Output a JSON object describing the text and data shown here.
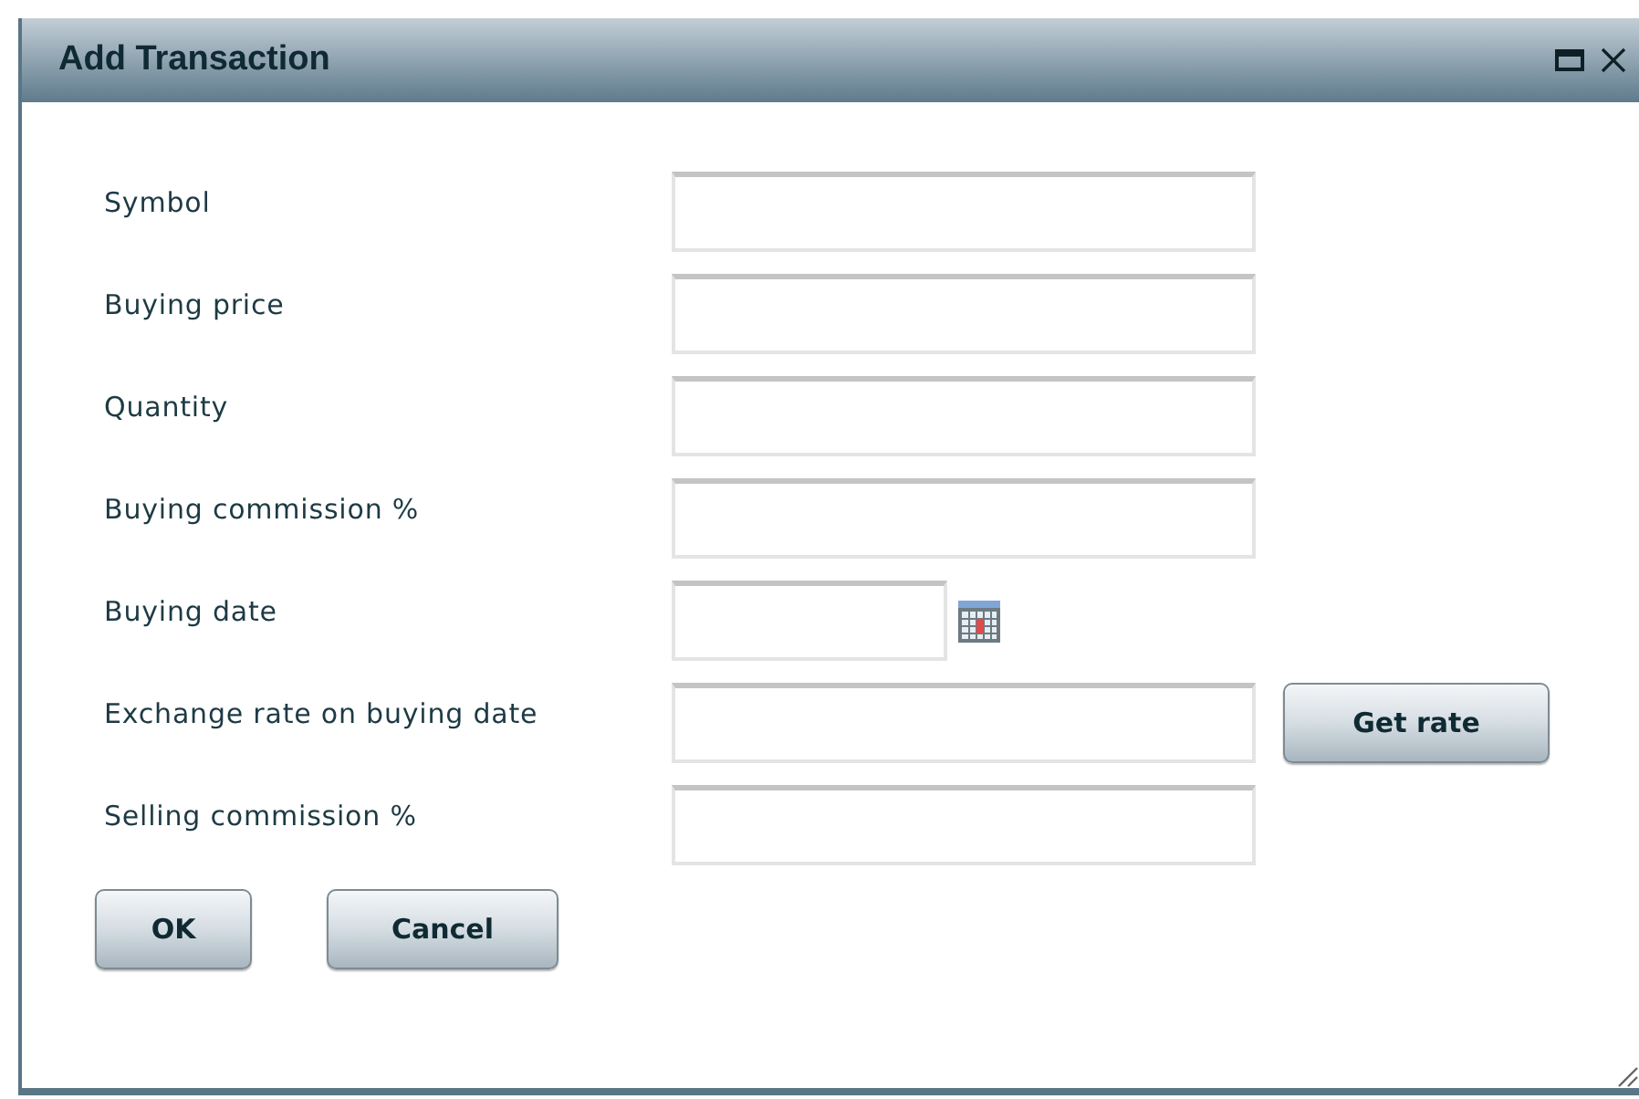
{
  "window": {
    "title": "Add Transaction"
  },
  "fields": [
    {
      "kind": "text",
      "label": "Symbol"
    },
    {
      "kind": "text",
      "label": "Buying price"
    },
    {
      "kind": "text",
      "label": "Quantity"
    },
    {
      "kind": "text",
      "label": "Buying commission %"
    },
    {
      "kind": "date",
      "label": "Buying date"
    },
    {
      "kind": "action",
      "label": "Exchange rate on buying date",
      "button": "Get rate"
    },
    {
      "kind": "text",
      "label": "Selling commission %"
    }
  ],
  "buttons": [
    "OK",
    "Cancel"
  ]
}
